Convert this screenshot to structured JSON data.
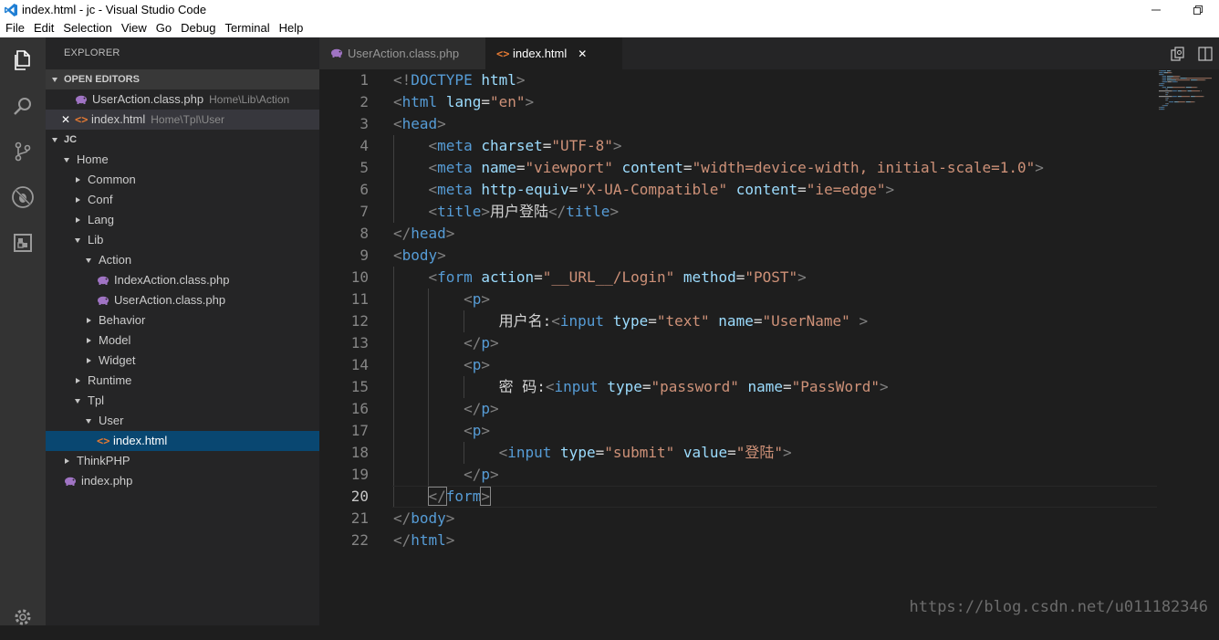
{
  "window": {
    "title": "index.html - jc - Visual Studio Code"
  },
  "menu": [
    "File",
    "Edit",
    "Selection",
    "View",
    "Go",
    "Debug",
    "Terminal",
    "Help"
  ],
  "activity_bar": [
    "files-icon",
    "search-icon",
    "source-control-icon",
    "debug-icon",
    "extensions-icon"
  ],
  "sidebar": {
    "title": "EXPLORER",
    "open_editors": {
      "label": "OPEN EDITORS",
      "items": [
        {
          "name": "UserAction.class.php",
          "path": "Home\\Lib\\Action",
          "icon": "php-icon"
        },
        {
          "name": "index.html",
          "path": "Home\\Tpl\\User",
          "icon": "html-icon",
          "close": "✕"
        }
      ]
    },
    "workspace": {
      "label": "JC",
      "tree": [
        {
          "label": "Home",
          "depth": 0,
          "state": "open"
        },
        {
          "label": "Common",
          "depth": 1,
          "state": "closed"
        },
        {
          "label": "Conf",
          "depth": 1,
          "state": "closed"
        },
        {
          "label": "Lang",
          "depth": 1,
          "state": "closed"
        },
        {
          "label": "Lib",
          "depth": 1,
          "state": "open"
        },
        {
          "label": "Action",
          "depth": 2,
          "state": "open"
        },
        {
          "label": "IndexAction.class.php",
          "depth": 3,
          "icon": "php-icon"
        },
        {
          "label": "UserAction.class.php",
          "depth": 3,
          "icon": "php-icon"
        },
        {
          "label": "Behavior",
          "depth": 2,
          "state": "closed"
        },
        {
          "label": "Model",
          "depth": 2,
          "state": "closed"
        },
        {
          "label": "Widget",
          "depth": 2,
          "state": "closed"
        },
        {
          "label": "Runtime",
          "depth": 1,
          "state": "closed"
        },
        {
          "label": "Tpl",
          "depth": 1,
          "state": "open"
        },
        {
          "label": "User",
          "depth": 2,
          "state": "open"
        },
        {
          "label": "index.html",
          "depth": 3,
          "icon": "html-icon",
          "selected": true
        },
        {
          "label": "ThinkPHP",
          "depth": 0,
          "state": "closed"
        },
        {
          "label": "index.php",
          "depth": 0,
          "icon": "php-icon"
        }
      ]
    }
  },
  "tabs": [
    {
      "label": "UserAction.class.php",
      "icon": "php-icon",
      "active": false
    },
    {
      "label": "index.html",
      "icon": "html-icon",
      "active": true,
      "close": "✕"
    }
  ],
  "editor": {
    "current_line": 20,
    "lines": [
      [
        [
          "br",
          "<!"
        ],
        [
          "tag",
          "DOCTYPE"
        ],
        [
          "txt",
          " "
        ],
        [
          "attr",
          "html"
        ],
        [
          "br",
          ">"
        ]
      ],
      [
        [
          "br",
          "<"
        ],
        [
          "tag",
          "html"
        ],
        [
          "txt",
          " "
        ],
        [
          "attr",
          "lang"
        ],
        [
          "txt",
          "="
        ],
        [
          "str",
          "\"en\""
        ],
        [
          "br",
          ">"
        ]
      ],
      [
        [
          "br",
          "<"
        ],
        [
          "tag",
          "head"
        ],
        [
          "br",
          ">"
        ]
      ],
      [
        [
          "txt",
          "    "
        ],
        [
          "br",
          "<"
        ],
        [
          "tag",
          "meta"
        ],
        [
          "txt",
          " "
        ],
        [
          "attr",
          "charset"
        ],
        [
          "txt",
          "="
        ],
        [
          "str",
          "\"UTF-8\""
        ],
        [
          "br",
          ">"
        ]
      ],
      [
        [
          "txt",
          "    "
        ],
        [
          "br",
          "<"
        ],
        [
          "tag",
          "meta"
        ],
        [
          "txt",
          " "
        ],
        [
          "attr",
          "name"
        ],
        [
          "txt",
          "="
        ],
        [
          "str",
          "\"viewport\""
        ],
        [
          "txt",
          " "
        ],
        [
          "attr",
          "content"
        ],
        [
          "txt",
          "="
        ],
        [
          "str",
          "\"width=device-width, initial-scale=1.0\""
        ],
        [
          "br",
          ">"
        ]
      ],
      [
        [
          "txt",
          "    "
        ],
        [
          "br",
          "<"
        ],
        [
          "tag",
          "meta"
        ],
        [
          "txt",
          " "
        ],
        [
          "attr",
          "http-equiv"
        ],
        [
          "txt",
          "="
        ],
        [
          "str",
          "\"X-UA-Compatible\""
        ],
        [
          "txt",
          " "
        ],
        [
          "attr",
          "content"
        ],
        [
          "txt",
          "="
        ],
        [
          "str",
          "\"ie=edge\""
        ],
        [
          "br",
          ">"
        ]
      ],
      [
        [
          "txt",
          "    "
        ],
        [
          "br",
          "<"
        ],
        [
          "tag",
          "title"
        ],
        [
          "br",
          ">"
        ],
        [
          "txt",
          "用户登陆"
        ],
        [
          "br",
          "</"
        ],
        [
          "tag",
          "title"
        ],
        [
          "br",
          ">"
        ]
      ],
      [
        [
          "br",
          "</"
        ],
        [
          "tag",
          "head"
        ],
        [
          "br",
          ">"
        ]
      ],
      [
        [
          "br",
          "<"
        ],
        [
          "tag",
          "body"
        ],
        [
          "br",
          ">"
        ]
      ],
      [
        [
          "txt",
          "    "
        ],
        [
          "br",
          "<"
        ],
        [
          "tag",
          "form"
        ],
        [
          "txt",
          " "
        ],
        [
          "attr",
          "action"
        ],
        [
          "txt",
          "="
        ],
        [
          "str",
          "\"__URL__/Login\""
        ],
        [
          "txt",
          " "
        ],
        [
          "attr",
          "method"
        ],
        [
          "txt",
          "="
        ],
        [
          "str",
          "\"POST\""
        ],
        [
          "br",
          ">"
        ]
      ],
      [
        [
          "txt",
          "        "
        ],
        [
          "br",
          "<"
        ],
        [
          "tag",
          "p"
        ],
        [
          "br",
          ">"
        ]
      ],
      [
        [
          "txt",
          "            用户名:"
        ],
        [
          "br",
          "<"
        ],
        [
          "tag",
          "input"
        ],
        [
          "txt",
          " "
        ],
        [
          "attr",
          "type"
        ],
        [
          "txt",
          "="
        ],
        [
          "str",
          "\"text\""
        ],
        [
          "txt",
          " "
        ],
        [
          "attr",
          "name"
        ],
        [
          "txt",
          "="
        ],
        [
          "str",
          "\"UserName\""
        ],
        [
          "txt",
          " "
        ],
        [
          "br",
          ">"
        ]
      ],
      [
        [
          "txt",
          "        "
        ],
        [
          "br",
          "</"
        ],
        [
          "tag",
          "p"
        ],
        [
          "br",
          ">"
        ]
      ],
      [
        [
          "txt",
          "        "
        ],
        [
          "br",
          "<"
        ],
        [
          "tag",
          "p"
        ],
        [
          "br",
          ">"
        ]
      ],
      [
        [
          "txt",
          "            密 码:"
        ],
        [
          "br",
          "<"
        ],
        [
          "tag",
          "input"
        ],
        [
          "txt",
          " "
        ],
        [
          "attr",
          "type"
        ],
        [
          "txt",
          "="
        ],
        [
          "str",
          "\"password\""
        ],
        [
          "txt",
          " "
        ],
        [
          "attr",
          "name"
        ],
        [
          "txt",
          "="
        ],
        [
          "str",
          "\"PassWord\""
        ],
        [
          "br",
          ">"
        ]
      ],
      [
        [
          "txt",
          "        "
        ],
        [
          "br",
          "</"
        ],
        [
          "tag",
          "p"
        ],
        [
          "br",
          ">"
        ]
      ],
      [
        [
          "txt",
          "        "
        ],
        [
          "br",
          "<"
        ],
        [
          "tag",
          "p"
        ],
        [
          "br",
          ">"
        ]
      ],
      [
        [
          "txt",
          "            "
        ],
        [
          "br",
          "<"
        ],
        [
          "tag",
          "input"
        ],
        [
          "txt",
          " "
        ],
        [
          "attr",
          "type"
        ],
        [
          "txt",
          "="
        ],
        [
          "str",
          "\"submit\""
        ],
        [
          "txt",
          " "
        ],
        [
          "attr",
          "value"
        ],
        [
          "txt",
          "="
        ],
        [
          "str",
          "\"登陆\""
        ],
        [
          "br",
          ">"
        ]
      ],
      [
        [
          "txt",
          "        "
        ],
        [
          "br",
          "</"
        ],
        [
          "tag",
          "p"
        ],
        [
          "br",
          ">"
        ]
      ],
      [
        [
          "txt",
          "    "
        ],
        [
          "br",
          "</"
        ],
        [
          "tag",
          "form"
        ],
        [
          "br",
          ">"
        ]
      ],
      [
        [
          "br",
          "</"
        ],
        [
          "tag",
          "body"
        ],
        [
          "br",
          ">"
        ]
      ],
      [
        [
          "br",
          "</"
        ],
        [
          "tag",
          "html"
        ],
        [
          "br",
          ">"
        ]
      ]
    ]
  },
  "watermark": "https://blog.csdn.net/u011182346"
}
